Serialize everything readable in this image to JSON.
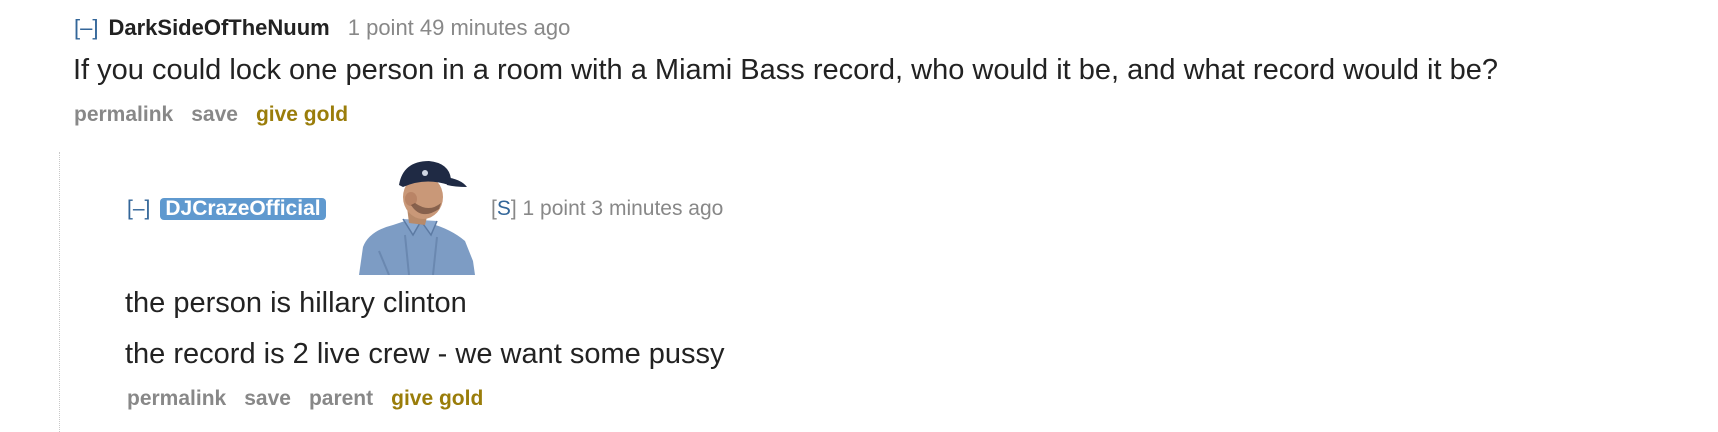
{
  "top_comment": {
    "expand_label": "[–]",
    "author": "DarkSideOfTheNuum",
    "meta": "1 point 49 minutes ago",
    "body": "If you could lock one person in a room with a Miami Bass record, who would it be, and what record would it be?",
    "buttons": {
      "permalink": "permalink",
      "save": "save",
      "give_gold": "give gold"
    }
  },
  "reply": {
    "expand_label": "[–]",
    "author": "DJCrazeOfficial",
    "flair_image": "man-in-cap-photo-icon",
    "submitter_open": "[",
    "submitter_label": "S",
    "submitter_close": "]",
    "meta": "1 point 3 minutes ago",
    "body_lines": [
      "the person is hillary clinton",
      "the record is 2 live crew - we want some pussy"
    ],
    "buttons": {
      "permalink": "permalink",
      "save": "save",
      "parent": "parent",
      "give_gold": "give gold"
    }
  },
  "colors": {
    "link_blue": "#336699",
    "author_badge_bg": "#5f99cf",
    "meta_gray": "#888888",
    "gold": "#9a7d0a"
  }
}
